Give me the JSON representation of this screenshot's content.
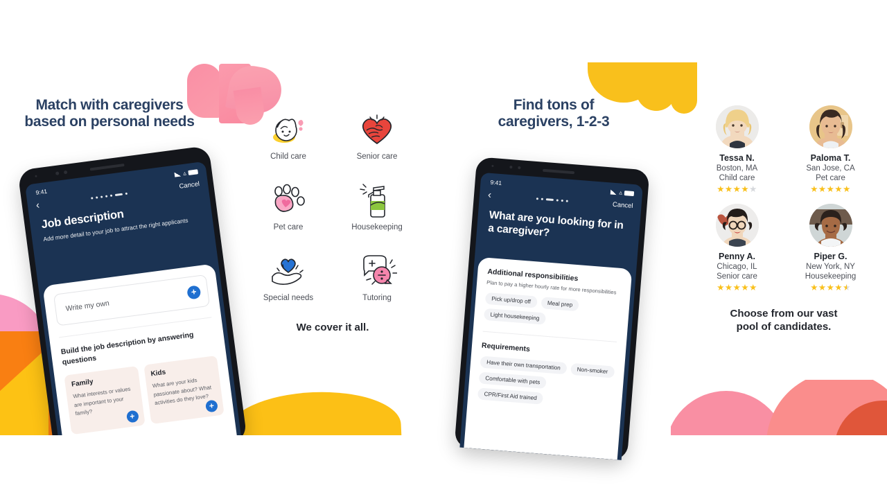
{
  "left_panel": {
    "headline": "Match with caregivers\nbased on personal needs",
    "phone": {
      "time": "9:41",
      "cancel_label": "Cancel",
      "back_icon": "chevron-left-icon",
      "title": "Job description",
      "subtitle": "Add more detail to your job to attract the right applicants",
      "write_own_label": "Write my own",
      "add_icon": "plus-icon",
      "build_title": "Build the job description by answering questions",
      "question_cards": [
        {
          "title": "Family",
          "body": "What interests or values are important to your family?"
        },
        {
          "title": "Kids",
          "body": "What are your kids passionate about? What activities do they love?"
        }
      ]
    },
    "services": [
      {
        "label": "Child care",
        "icon": "child-face-icon"
      },
      {
        "label": "Senior care",
        "icon": "heart-hands-icon"
      },
      {
        "label": "Pet care",
        "icon": "paw-print-icon"
      },
      {
        "label": "Housekeeping",
        "icon": "spray-bottle-icon"
      },
      {
        "label": "Special needs",
        "icon": "hand-heart-icon"
      },
      {
        "label": "Tutoring",
        "icon": "speech-bubbles-math-icon"
      }
    ],
    "tagline": "We cover it all."
  },
  "right_panel": {
    "headline": "Find tons of\ncaregivers, 1-2-3",
    "phone": {
      "time": "9:41",
      "cancel_label": "Cancel",
      "back_icon": "chevron-left-icon",
      "title": "What are you looking for in a caregiver?",
      "sections": [
        {
          "title": "Additional responsibilities",
          "subtitle": "Plan to pay a higher hourly rate for more responsibilities",
          "chips": [
            "Pick up/drop off",
            "Meal prep",
            "Light housekeeping"
          ]
        },
        {
          "title": "Requirements",
          "subtitle": "",
          "chips": [
            "Have their own transportation",
            "Non-smoker",
            "Comfortable with pets",
            "CPR/First Aid trained"
          ]
        }
      ]
    },
    "caregivers": [
      {
        "name": "Tessa N.",
        "location": "Boston, MA",
        "service": "Child care",
        "rating": 4.0
      },
      {
        "name": "Paloma T.",
        "location": "San Jose, CA",
        "service": "Pet care",
        "rating": 5.0
      },
      {
        "name": "Penny A.",
        "location": "Chicago, IL",
        "service": "Senior care",
        "rating": 5.0
      },
      {
        "name": "Piper G.",
        "location": "New York, NY",
        "service": "Housekeeping",
        "rating": 4.5
      }
    ],
    "tagline": "Choose from our vast\npool of candidates."
  },
  "colors": {
    "headline_navy": "#2b4163",
    "phone_screen_navy": "#1b3353",
    "accent_blue": "#1f6fd0",
    "star_gold": "#f9c01c",
    "star_grey": "#d6d8dc",
    "deco_pink": "#f98fa5",
    "deco_yellow": "#f9c01c",
    "deco_orange": "#f97f12",
    "deco_red": "#e0563a",
    "card_peach": "#f8eeea",
    "chip_grey": "#f2f3f6",
    "background": "#ffffff"
  }
}
